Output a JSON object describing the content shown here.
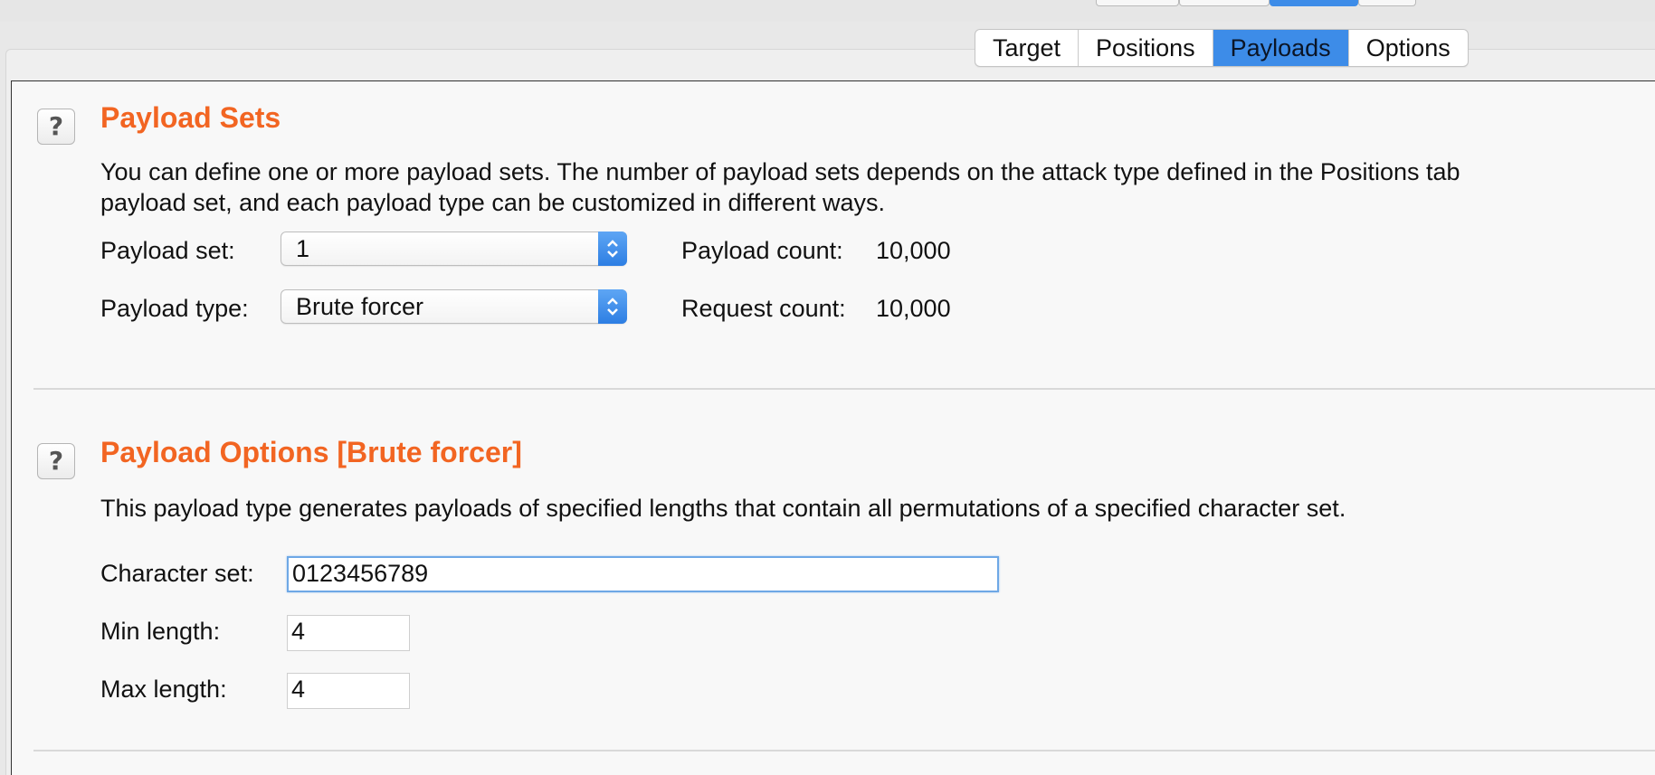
{
  "tabs": [
    {
      "label": "Target",
      "active": false
    },
    {
      "label": "Positions",
      "active": false
    },
    {
      "label": "Payloads",
      "active": true
    },
    {
      "label": "Options",
      "active": false
    }
  ],
  "payload_sets": {
    "title": "Payload Sets",
    "description_line1": "You can define one or more payload sets. The number of payload sets depends on the attack type defined in the Positions tab",
    "description_line2": "payload set, and each payload type can be customized in different ways.",
    "payload_set_label": "Payload set:",
    "payload_set_value": "1",
    "payload_type_label": "Payload type:",
    "payload_type_value": "Brute forcer",
    "payload_count_label": "Payload count:",
    "payload_count_value": "10,000",
    "request_count_label": "Request count:",
    "request_count_value": "10,000"
  },
  "payload_options": {
    "title": "Payload Options [Brute forcer]",
    "description": "This payload type generates payloads of specified lengths that contain all permutations of a specified character set.",
    "character_set_label": "Character set:",
    "character_set_value": "0123456789",
    "min_length_label": "Min length:",
    "min_length_value": "4",
    "max_length_label": "Max length:",
    "max_length_value": "4"
  },
  "help_icon_glyph": "?",
  "colors": {
    "accent_orange": "#f26522",
    "tab_active_blue": "#3d8ce8",
    "focus_blue": "#6ea8e6"
  }
}
